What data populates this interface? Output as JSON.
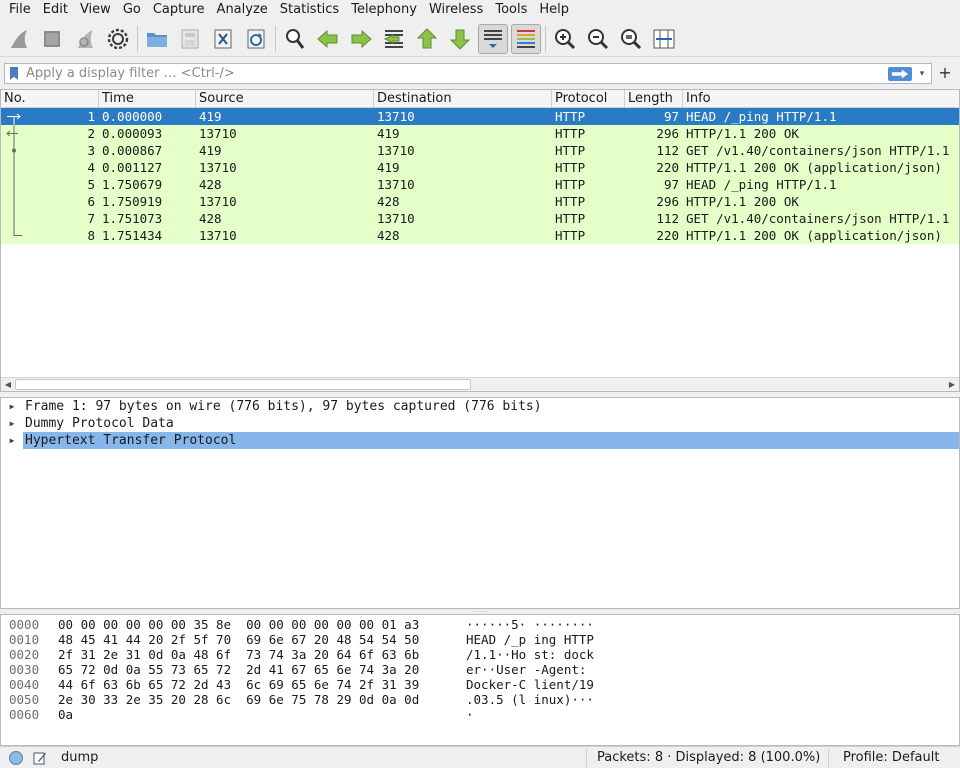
{
  "menu": [
    "File",
    "Edit",
    "View",
    "Go",
    "Capture",
    "Analyze",
    "Statistics",
    "Telephony",
    "Wireless",
    "Tools",
    "Help"
  ],
  "toolbar": {
    "icons": [
      "shark-fin-start-icon",
      "stop-square-icon",
      "restart-capture-icon",
      "capture-options-gear-icon",
      "open-folder-icon",
      "save-file-icon",
      "close-file-icon",
      "reload-file-icon",
      "find-packet-icon",
      "go-back-arrow-icon",
      "go-forward-arrow-icon",
      "go-to-packet-icon",
      "first-packet-icon",
      "last-packet-icon",
      "autoscroll-icon",
      "colorize-icon",
      "zoom-in-icon",
      "zoom-out-icon",
      "zoom-normal-icon",
      "resize-columns-icon"
    ]
  },
  "filter": {
    "placeholder": "Apply a display filter … <Ctrl-/>",
    "value": "",
    "add_label": "+"
  },
  "packet_list": {
    "columns": [
      "No.",
      "Time",
      "Source",
      "Destination",
      "Protocol",
      "Length",
      "Info"
    ],
    "rows": [
      {
        "no": "1",
        "time": "0.000000",
        "source": "419",
        "destination": "13710",
        "protocol": "HTTP",
        "length": "97",
        "info": "HEAD /_ping HTTP/1.1",
        "selected": true
      },
      {
        "no": "2",
        "time": "0.000093",
        "source": "13710",
        "destination": "419",
        "protocol": "HTTP",
        "length": "296",
        "info": "HTTP/1.1 200 OK"
      },
      {
        "no": "3",
        "time": "0.000867",
        "source": "419",
        "destination": "13710",
        "protocol": "HTTP",
        "length": "112",
        "info": "GET /v1.40/containers/json HTTP/1.1"
      },
      {
        "no": "4",
        "time": "0.001127",
        "source": "13710",
        "destination": "419",
        "protocol": "HTTP",
        "length": "220",
        "info": "HTTP/1.1 200 OK  (application/json)"
      },
      {
        "no": "5",
        "time": "1.750679",
        "source": "428",
        "destination": "13710",
        "protocol": "HTTP",
        "length": "97",
        "info": "HEAD /_ping HTTP/1.1"
      },
      {
        "no": "6",
        "time": "1.750919",
        "source": "13710",
        "destination": "428",
        "protocol": "HTTP",
        "length": "296",
        "info": "HTTP/1.1 200 OK"
      },
      {
        "no": "7",
        "time": "1.751073",
        "source": "428",
        "destination": "13710",
        "protocol": "HTTP",
        "length": "112",
        "info": "GET /v1.40/containers/json HTTP/1.1"
      },
      {
        "no": "8",
        "time": "1.751434",
        "source": "13710",
        "destination": "428",
        "protocol": "HTTP",
        "length": "220",
        "info": "HTTP/1.1 200 OK  (application/json)"
      }
    ]
  },
  "details": [
    {
      "text": "Frame 1: 97 bytes on wire (776 bits), 97 bytes captured (776 bits)"
    },
    {
      "text": "Dummy Protocol Data"
    },
    {
      "text": "Hypertext Transfer Protocol",
      "selected": true
    }
  ],
  "bytes": [
    {
      "offset": "0000",
      "hex": "00 00 00 00 00 00 35 8e  00 00 00 00 00 00 01 a3",
      "ascii": "······5· ········"
    },
    {
      "offset": "0010",
      "hex": "48 45 41 44 20 2f 5f 70  69 6e 67 20 48 54 54 50",
      "ascii": "HEAD /_p ing HTTP"
    },
    {
      "offset": "0020",
      "hex": "2f 31 2e 31 0d 0a 48 6f  73 74 3a 20 64 6f 63 6b",
      "ascii": "/1.1··Ho st: dock"
    },
    {
      "offset": "0030",
      "hex": "65 72 0d 0a 55 73 65 72  2d 41 67 65 6e 74 3a 20",
      "ascii": "er··User -Agent: "
    },
    {
      "offset": "0040",
      "hex": "44 6f 63 6b 65 72 2d 43  6c 69 65 6e 74 2f 31 39",
      "ascii": "Docker-C lient/19"
    },
    {
      "offset": "0050",
      "hex": "2e 30 33 2e 35 20 28 6c  69 6e 75 78 29 0d 0a 0d",
      "ascii": ".03.5 (l inux)···"
    },
    {
      "offset": "0060",
      "hex": "0a",
      "ascii": "·"
    }
  ],
  "status": {
    "file": "dump",
    "packets": "Packets: 8 · Displayed: 8 (100.0%)",
    "profile": "Profile: Default"
  },
  "colors": {
    "row_http": "#e4ffc7",
    "row_selected": "#2a7bc4",
    "detail_selected": "#86b6ea"
  }
}
